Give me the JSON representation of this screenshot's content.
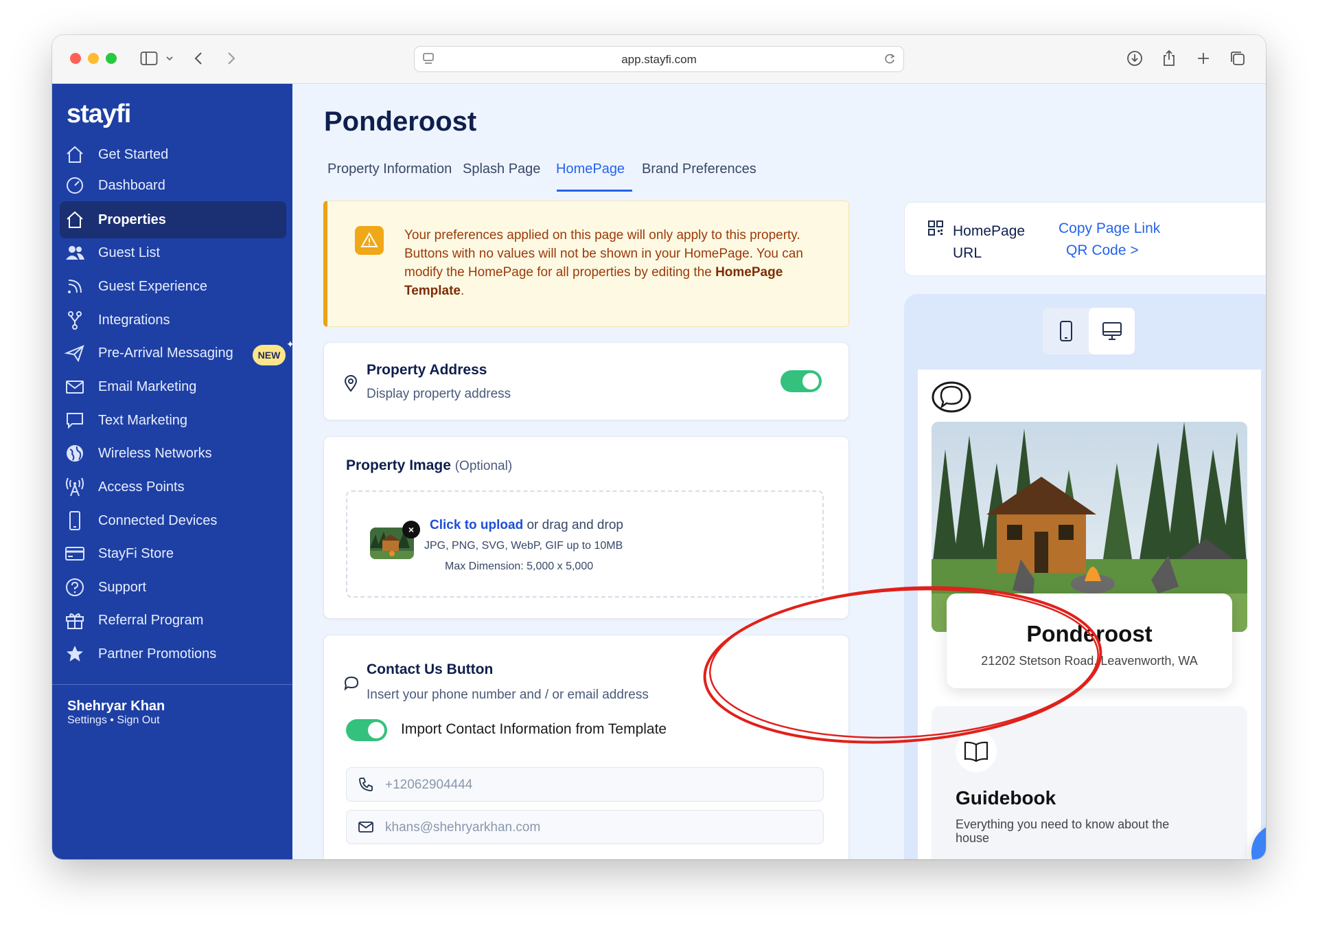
{
  "browser": {
    "url": "app.stayfi.com"
  },
  "logo": {
    "text": "stayfi"
  },
  "sidebar": {
    "items": [
      {
        "label": "Get Started",
        "icon": "home-icon"
      },
      {
        "label": "Dashboard",
        "icon": "gauge-icon"
      },
      {
        "label": "Properties",
        "icon": "house-icon",
        "active": true
      },
      {
        "label": "Guest List",
        "icon": "users-icon"
      },
      {
        "label": "Guest Experience",
        "icon": "rss-icon"
      },
      {
        "label": "Integrations",
        "icon": "integration-icon"
      },
      {
        "label": "Pre-Arrival Messaging",
        "icon": "paper-plane-icon",
        "badge": "NEW"
      },
      {
        "label": "Email Marketing",
        "icon": "envelope-icon"
      },
      {
        "label": "Text Marketing",
        "icon": "message-icon"
      },
      {
        "label": "Wireless Networks",
        "icon": "globe-icon"
      },
      {
        "label": "Access Points",
        "icon": "antenna-icon"
      },
      {
        "label": "Connected Devices",
        "icon": "phone-icon"
      },
      {
        "label": "StayFi Store",
        "icon": "credit-card-icon"
      },
      {
        "label": "Support",
        "icon": "question-icon"
      },
      {
        "label": "Referral Program",
        "icon": "gift-icon"
      },
      {
        "label": "Partner Promotions",
        "icon": "star-icon"
      }
    ],
    "user": {
      "name": "Shehryar Khan",
      "settings": "Settings",
      "separator": "•",
      "signout": "Sign Out"
    }
  },
  "main": {
    "title": "Ponderoost",
    "tabs": [
      {
        "label": "Property Information"
      },
      {
        "label": "Splash Page"
      },
      {
        "label": "HomePage",
        "active": true
      },
      {
        "label": "Brand Preferences"
      }
    ],
    "alert": {
      "text_before": "Your preferences applied on this page will only apply to this property. Buttons with no values will not be shown in your HomePage. You can modify the HomePage for all properties by editing the ",
      "link_text": "HomePage Template",
      "text_after": "."
    },
    "address_card": {
      "title": "Property Address",
      "subtitle": "Display property address",
      "toggle_on": true
    },
    "image_card": {
      "title": "Property Image",
      "optional": "(Optional)",
      "upload_link": "Click to upload",
      "upload_rest": "or drag and drop",
      "formats": "JPG, PNG, SVG, WebP, GIF up to 10MB",
      "dimension": "Max Dimension: 5,000 x 5,000",
      "remove": "×"
    },
    "contact_card": {
      "title": "Contact Us Button",
      "subtitle": "Insert your phone number and / or email address",
      "import_label": "Import Contact Information from Template",
      "toggle_on": true,
      "phone_value": "+12062904444",
      "email_value": "khans@shehryarkhan.com"
    }
  },
  "right": {
    "url_label": "HomePage URL",
    "copy_link": "Copy Page Link",
    "qr_code": "QR Code >",
    "preview": {
      "property_name": "Ponderoost",
      "address": "21202 Stetson Road, Leavenworth, WA",
      "guidebook_title": "Guidebook",
      "guidebook_desc": "Everything you need to know about the house"
    }
  },
  "colors": {
    "sidebar": "#1e40a4",
    "active_nav": "#1b2f73",
    "accent": "#2563eb",
    "toggle": "#34c17d",
    "alert_border": "#e8a317",
    "annotation": "#e0211b"
  }
}
